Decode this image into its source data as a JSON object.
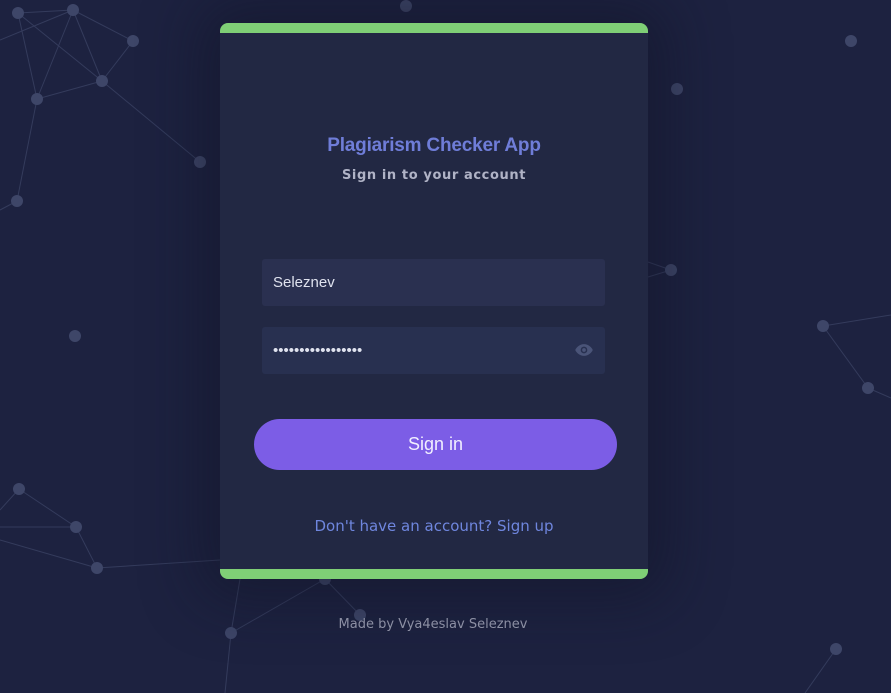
{
  "app": {
    "title": "Plagiarism Checker App",
    "subtitle": "Sign in to your account"
  },
  "form": {
    "username_value": "Seleznev",
    "password_value": "•••••••••••••••••",
    "password_toggle_icon": "eye-icon",
    "submit_label": "Sign in"
  },
  "links": {
    "signup_text": "Don't have an account? Sign up"
  },
  "footer": {
    "credit": "Made by Vya4eslav Seleznev"
  },
  "colors": {
    "background": "#1d2240",
    "card": "#222843",
    "accent_bar": "#7fcf76",
    "title": "#6f7dd8",
    "button": "#7c5de6",
    "link": "#6f86de"
  }
}
